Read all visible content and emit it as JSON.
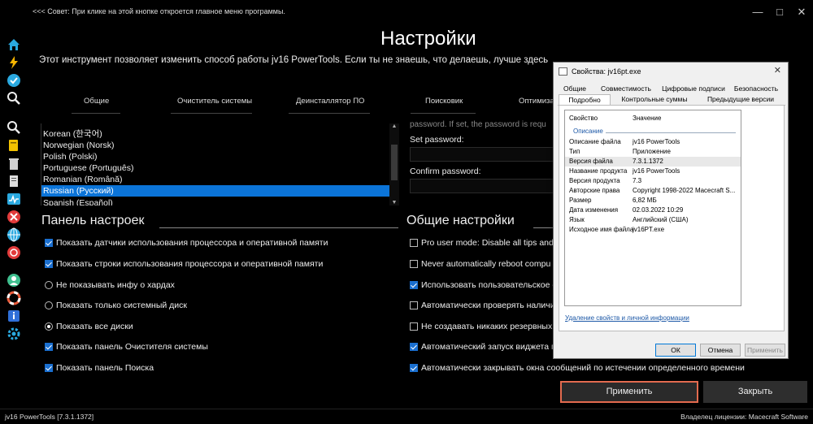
{
  "window": {
    "hint": "<<< Совет: При клике на этой кнопке откроется главное меню программы.",
    "min": "—",
    "max": "□",
    "close": "✕"
  },
  "page": {
    "title": "Настройки",
    "intro": "Этот инструмент позволяет изменить способ работы jv16 PowerTools. Если ты не знаешь, что делаешь, лучше здесь ничего не менять."
  },
  "tabs": [
    "Общие",
    "Очиститель системы",
    "Деинсталлятор ПО",
    "Поисковик",
    "Оптимизат"
  ],
  "languages": {
    "items": [
      "Korean (한국어)",
      "Norwegian (Norsk)",
      "Polish (Polski)",
      "Portuguese (Português)",
      "Romanian (Română)",
      "Russian (Русский)",
      "Spanish (Español)"
    ],
    "selected": "Russian (Русский)"
  },
  "password": {
    "top_text": "password. If set, the password is requ",
    "set_label": "Set password:",
    "confirm_label": "Confirm password:"
  },
  "panel_settings": {
    "title": "Панель настроек",
    "options": [
      {
        "label": "Показать датчики использования процессора и оперативной памяти",
        "type": "check",
        "on": true
      },
      {
        "label": "Показать строки использования процессора и оперативной памяти",
        "type": "check",
        "on": true
      },
      {
        "label": "Не показывать инфу о хардах",
        "type": "radio",
        "on": false
      },
      {
        "label": "Показать только системный диск",
        "type": "radio",
        "on": false
      },
      {
        "label": "Показать все диски",
        "type": "radio",
        "on": true
      },
      {
        "label": "Показать панель Очистителя системы",
        "type": "check",
        "on": true
      },
      {
        "label": "Показать панель Поиска",
        "type": "check",
        "on": true
      }
    ]
  },
  "general_settings": {
    "title": "Общие настройки",
    "options": [
      {
        "label": "Pro user mode: Disable all tips and",
        "type": "check",
        "on": false
      },
      {
        "label": "Never automatically reboot compu",
        "type": "check",
        "on": false
      },
      {
        "label": "Использовать пользовательское с",
        "type": "check",
        "on": true
      },
      {
        "label": "Автоматически проверять наличи",
        "type": "check",
        "on": false
      },
      {
        "label": "Не создавать никаких резервных",
        "type": "check",
        "on": false
      },
      {
        "label": "Автоматический запуск виджета п",
        "type": "check",
        "on": true
      },
      {
        "label": "Автоматически закрывать окна сообщений по истечении определенного времени",
        "type": "check",
        "on": true
      }
    ]
  },
  "buttons": {
    "apply": "Применить",
    "close": "Закрыть"
  },
  "status": {
    "left": "jv16 PowerTools [7.3.1.1372]",
    "right": "Владелец лицензии: Macecraft Software"
  },
  "dialog": {
    "title": "Свойства: jv16pt.exe",
    "close": "✕",
    "tabs_row1": [
      "Общие",
      "Совместимость",
      "Цифровые подписи",
      "Безопасность"
    ],
    "tabs_row2": [
      "Подробно",
      "Контрольные суммы",
      "Предыдущие версии"
    ],
    "header_key": "Свойство",
    "header_value": "Значение",
    "group": "Описание",
    "rows": [
      {
        "k": "Описание файла",
        "v": "jv16 PowerTools"
      },
      {
        "k": "Тип",
        "v": "Приложение"
      },
      {
        "k": "Версия файла",
        "v": "7.3.1.1372"
      },
      {
        "k": "Название продукта",
        "v": "jv16 PowerTools"
      },
      {
        "k": "Версия продукта",
        "v": "7.3"
      },
      {
        "k": "Авторские права",
        "v": "Copyright 1998-2022 Macecraft S..."
      },
      {
        "k": "Размер",
        "v": "6,82 МБ"
      },
      {
        "k": "Дата изменения",
        "v": "02.03.2022 10:29"
      },
      {
        "k": "Язык",
        "v": "Английский (США)"
      },
      {
        "k": "Исходное имя файла",
        "v": "jv16PT.exe"
      }
    ],
    "link": "Удаление свойств и личной информации",
    "ok": "ОК",
    "cancel": "Отмена",
    "apply": "Применить"
  },
  "colors": {
    "accent": "#0b74d8",
    "apply_border": "#e36b4f"
  }
}
